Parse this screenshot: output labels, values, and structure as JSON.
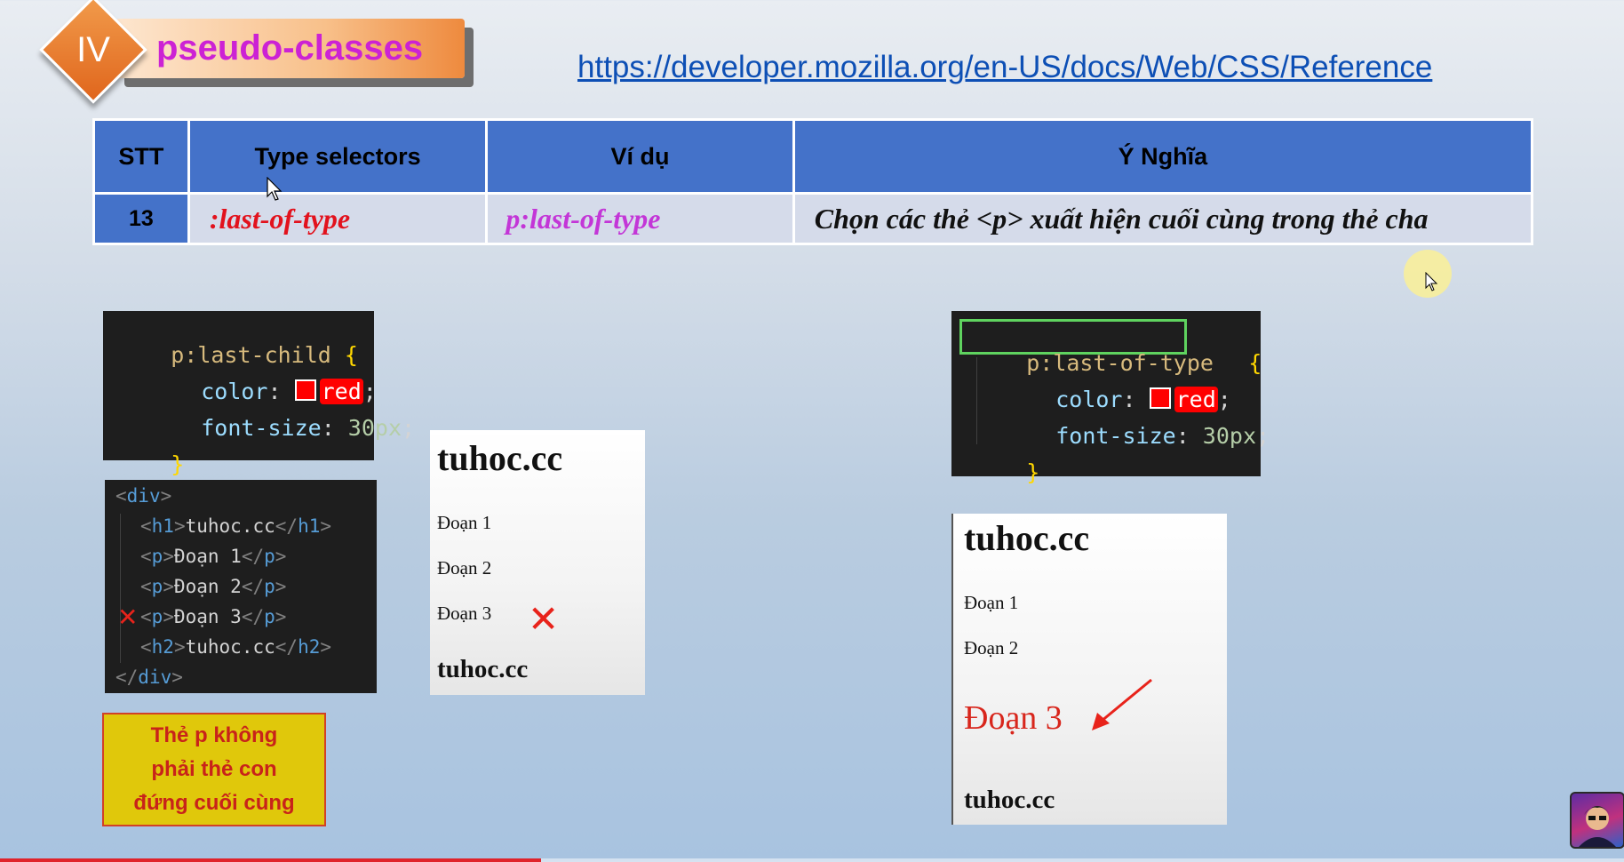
{
  "header": {
    "roman_numeral": "IV",
    "title": "pseudo-classes",
    "reference_url": "https://developer.mozilla.org/en-US/docs/Web/CSS/Reference"
  },
  "table": {
    "headers": [
      "STT",
      "Type selectors",
      "Ví dụ",
      "Ý Nghĩa"
    ],
    "row": {
      "stt": "13",
      "selector": ":last-of-type",
      "example": "p:last-of-type",
      "meaning": "Chọn các thẻ <p> xuất hiện cuối cùng trong thẻ cha"
    }
  },
  "css_left": {
    "selector": "p:last-child",
    "brace_open": " {",
    "prop1": "color",
    "value1": "red",
    "prop2": "font-size",
    "value2": "30px",
    "brace_close": "}"
  },
  "html_code": {
    "div_tag": "div",
    "h1_tag": "h1",
    "h1_text": "tuhoc.cc",
    "p_tag": "p",
    "p1_text": "Đoạn 1",
    "p2_text": "Đoạn 2",
    "p3_text": "Đoạn 3",
    "h2_tag": "h2",
    "h2_text": "tuhoc.cc",
    "wrong_mark": "✕"
  },
  "preview_left": {
    "h1": "tuhoc.cc",
    "p1": "Đoạn 1",
    "p2": "Đoạn 2",
    "p3": "Đoạn 3",
    "h2": "tuhoc.cc",
    "wrong_mark": "✕"
  },
  "note": {
    "line1": "Thẻ p không",
    "line2": "phải thẻ con",
    "line3": "đứng cuối cùng"
  },
  "css_right": {
    "selector": "p:last-of-type",
    "brace_open": "{",
    "prop1": "color",
    "value1": "red",
    "prop2": "font-size",
    "value2": "30px",
    "brace_close": "}"
  },
  "preview_right": {
    "h1": "tuhoc.cc",
    "p1": "Đoạn 1",
    "p2": "Đoạn 2",
    "p3": "Đoạn 3",
    "h2": "tuhoc.cc"
  },
  "video": {
    "progress_fraction": 0.333
  },
  "colors": {
    "table_header": "#4472c9",
    "selector_red": "#e2121d",
    "example_purple": "#c336d7",
    "title_magenta": "#cc22d4",
    "link_blue": "#0d4fb5",
    "note_yellow": "#e0c80b",
    "highlight_green": "#5fd35f"
  }
}
